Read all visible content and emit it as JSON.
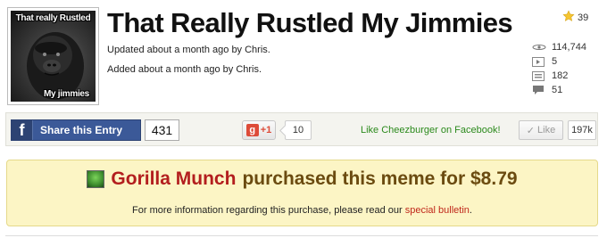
{
  "entry": {
    "title": "That Really Rustled My Jimmies",
    "updated_text": "Updated about a month ago by Chris.",
    "added_text": "Added about a month ago by Chris.",
    "thumbnail": {
      "top_caption": "That really Rustled",
      "bottom_caption": "My jimmies"
    }
  },
  "stats": {
    "favorites": "39",
    "views": "114,744",
    "videos": "5",
    "images": "182",
    "comments": "51",
    "icons": {
      "favorites": "star-icon",
      "views": "eye-icon",
      "videos": "video-icon",
      "images": "image-icon",
      "comments": "comment-icon"
    }
  },
  "share": {
    "fb_share_label": "Share this Entry",
    "fb_share_count": "431",
    "gplus_label": "+1",
    "gplus_count": "10",
    "like_cheezburger": "Like Cheezburger on Facebook!",
    "like_label": "Like",
    "like_count": "197k"
  },
  "promo": {
    "buyer": "Gorilla Munch",
    "purchase_text": "purchased this meme for $8.79",
    "info_text": "For more information regarding this purchase, please read our",
    "link_text": "special bulletin",
    "info_suffix": "."
  },
  "colors": {
    "facebook_blue": "#3b5998",
    "gplus_red": "#dd4b39",
    "promo_background": "#fcf5c5",
    "promo_buyer": "#b31e1e",
    "promo_text": "#6b4b10",
    "like_green": "#2b8a1c"
  }
}
